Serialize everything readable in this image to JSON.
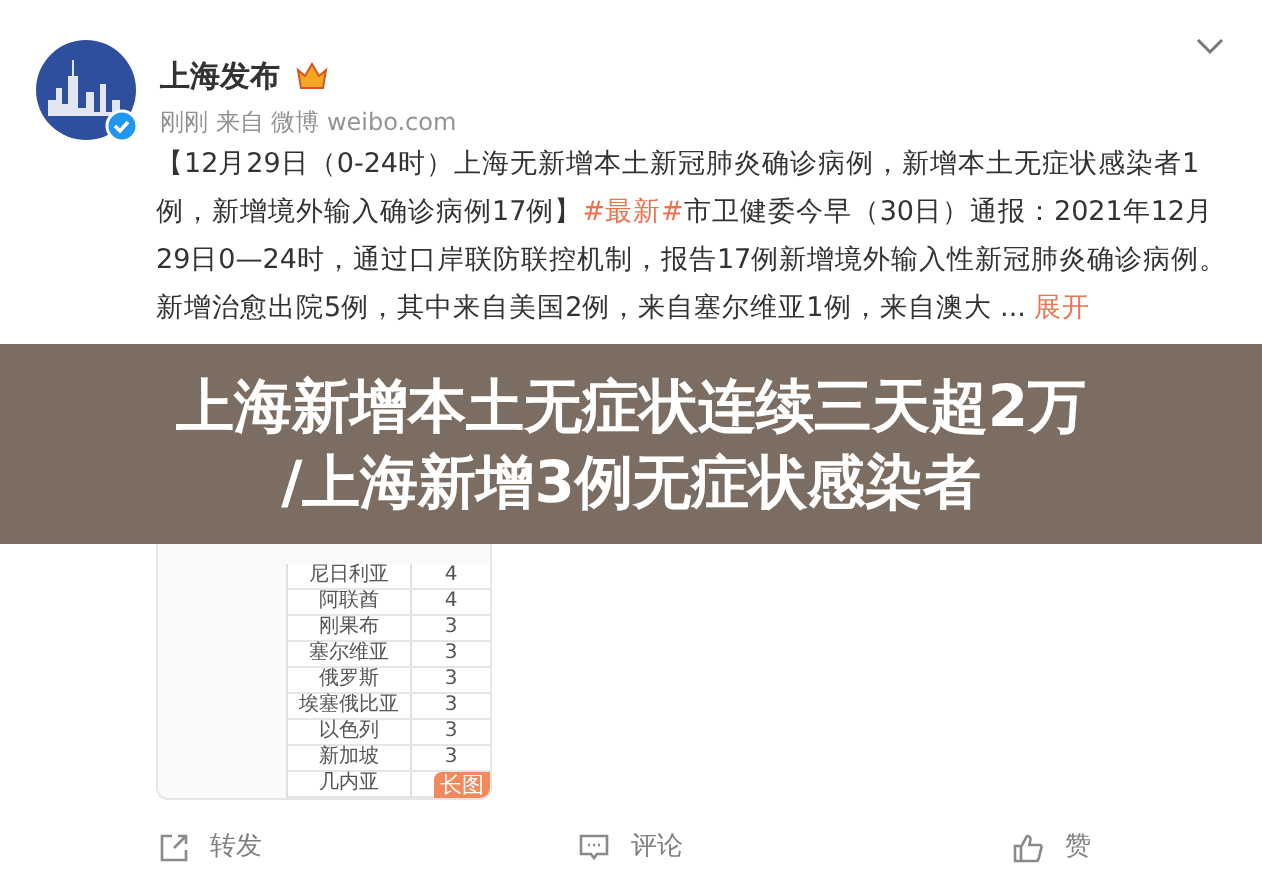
{
  "post": {
    "author": "上海发布",
    "meta": "刚刚 来自 微博 weibo.com",
    "body": [
      {
        "kind": "text",
        "text": "【12月29日（0-24时）上海无新增本土新冠肺炎确诊病例，新增本土无症状感染者1例，新增境外输入确诊病例17例】"
      },
      {
        "kind": "hashtag",
        "text": "#最新#"
      },
      {
        "kind": "text",
        "text": "市卫健委今早（30日）通报：2021年12月29日0—24时，通过口岸联防联控机制，报告17例新增境外输入性新冠肺炎确诊病例。新增治愈出院5例，其中来自美国2例，来自塞尔维亚1例，来自澳大 ..."
      }
    ],
    "expand_link": "展开",
    "image": {
      "table_rows": [
        [
          "尼日利亚",
          "4"
        ],
        [
          "阿联酋",
          "4"
        ],
        [
          "刚果布",
          "3"
        ],
        [
          "塞尔维亚",
          "3"
        ],
        [
          "俄罗斯",
          "3"
        ],
        [
          "埃塞俄比亚",
          "3"
        ],
        [
          "以色列",
          "3"
        ],
        [
          "新加坡",
          "3"
        ],
        [
          "几内亚"
        ]
      ],
      "badge": "长图"
    },
    "actions": [
      {
        "kind": "repost",
        "label": "转发"
      },
      {
        "kind": "comment",
        "label": "评论"
      },
      {
        "kind": "like",
        "label": "赞"
      }
    ]
  },
  "banner": {
    "lines": [
      "上海新增本土无症状连续三天超2万",
      "/上海新增3例无症状感染者"
    ]
  }
}
